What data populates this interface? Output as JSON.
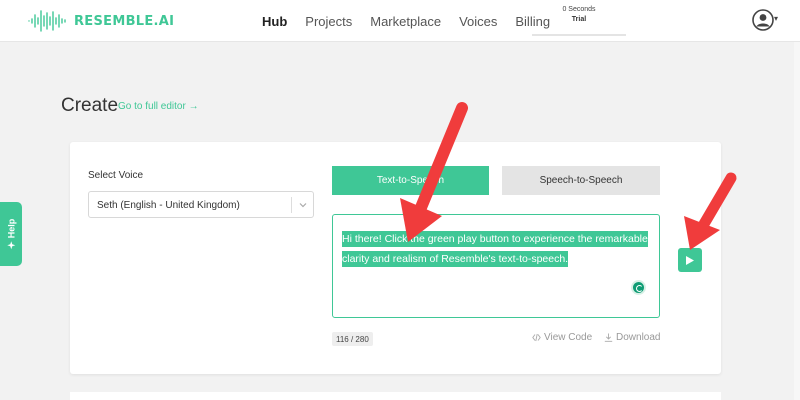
{
  "brand": {
    "name": "RESEMBLE.AI",
    "color": "#3fc796",
    "icon": "waveform-logo-icon"
  },
  "nav": [
    {
      "label": "Hub",
      "active": true
    },
    {
      "label": "Projects",
      "active": false
    },
    {
      "label": "Marketplace",
      "active": false
    },
    {
      "label": "Voices",
      "active": false
    },
    {
      "label": "Billing",
      "active": false
    }
  ],
  "credits": {
    "seconds": "0 Seconds",
    "plan": "Trial"
  },
  "user": {
    "icon": "user-avatar-icon",
    "caret": "▾"
  },
  "help": {
    "label": "Help",
    "icon": "sparkle-icon"
  },
  "page": {
    "title": "Create",
    "editor_link": "Go to full editor →"
  },
  "voice": {
    "label": "Select Voice",
    "selected": "Seth (English - United Kingdom)"
  },
  "mode_tabs": {
    "text_to_speech": "Text-to-Speech",
    "speech_to_speech": "Speech-to-Speech"
  },
  "editor": {
    "text": "Hi there! Click the green play button to experience the remarkable clarity and realism of Resemble's text-to-speech.",
    "char_count": "116 / 280"
  },
  "actions": {
    "view_code": "View Code",
    "download": "Download",
    "play_icon": "play-icon"
  },
  "annotations": {
    "arrow_color": "#f03c3c"
  }
}
